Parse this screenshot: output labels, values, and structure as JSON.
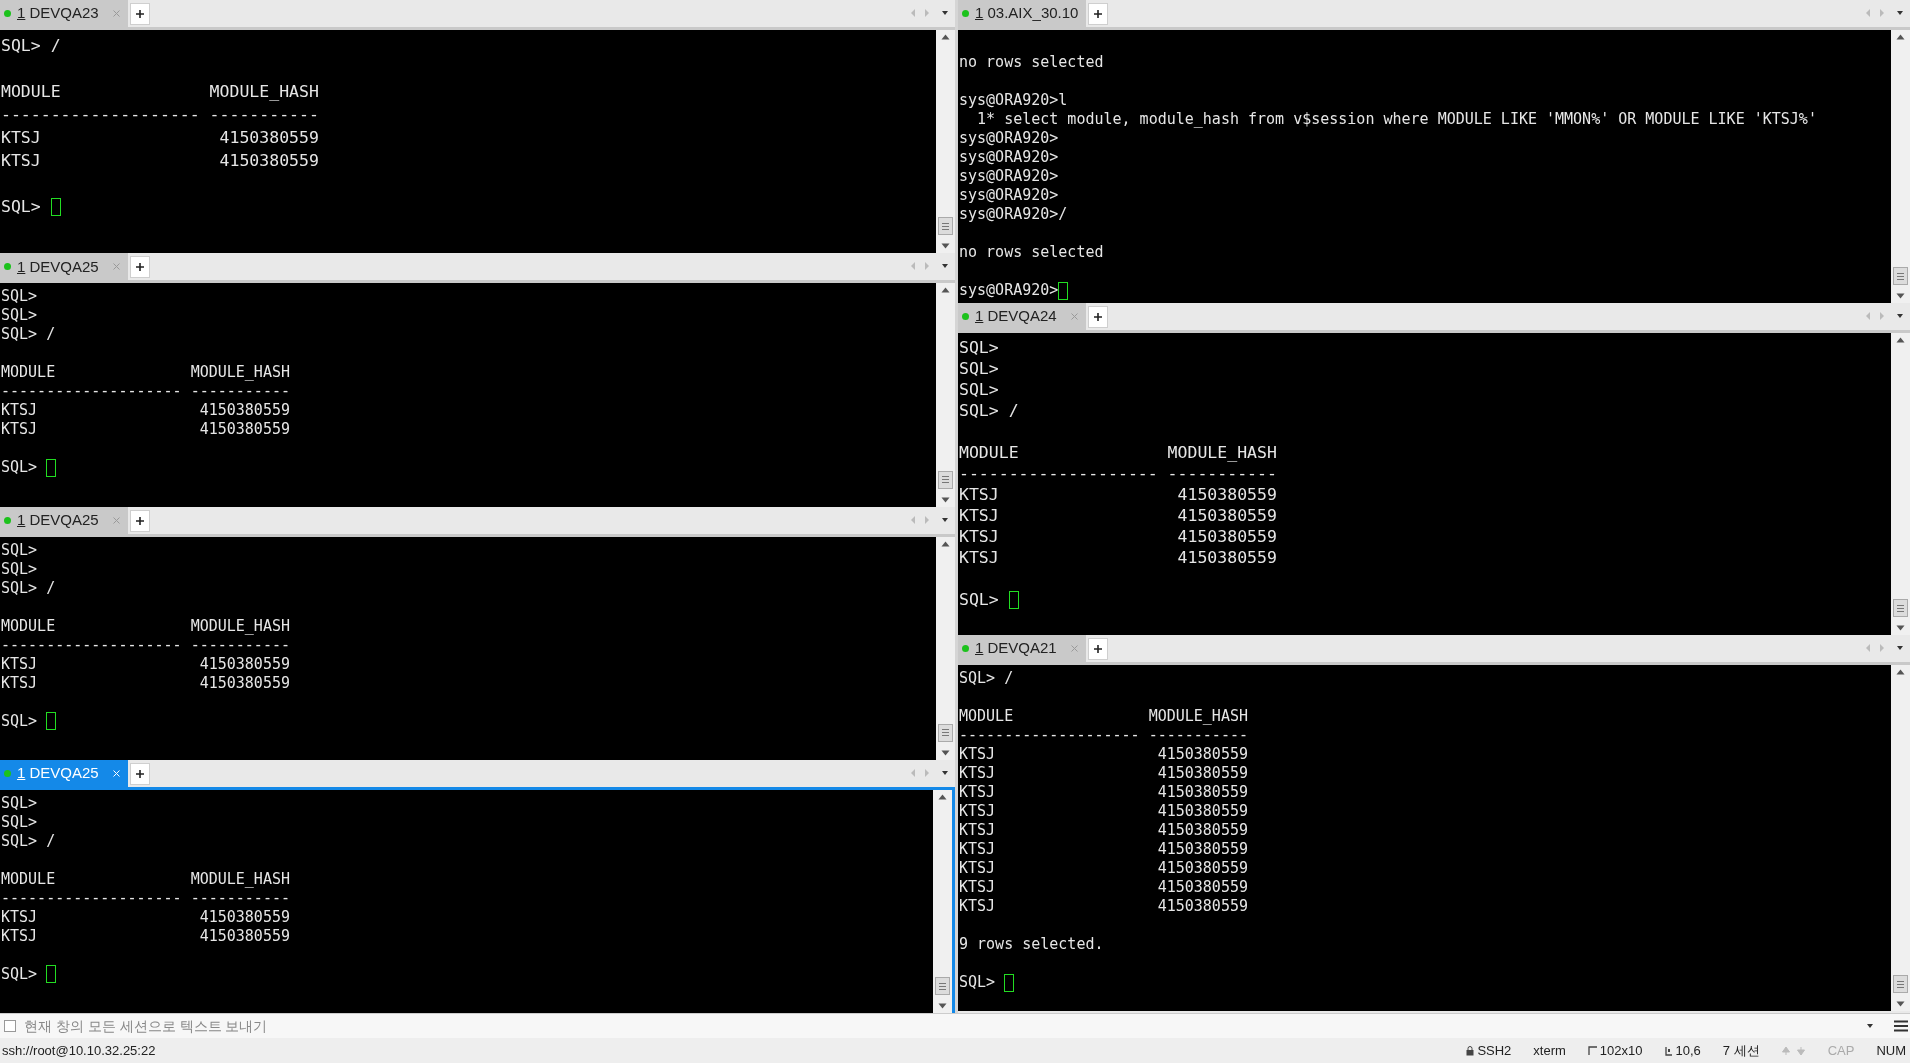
{
  "left_panes": [
    {
      "tab": {
        "number": "1",
        "name": "DEVQA23",
        "selected": false
      },
      "lines": [
        {
          "kind": "text",
          "text": "SQL> /"
        },
        {
          "kind": "blank"
        },
        {
          "kind": "text",
          "text": "MODULE               MODULE_HASH"
        },
        {
          "kind": "text",
          "text": "-------------------- -----------"
        },
        {
          "kind": "text",
          "text": "KTSJ                  4150380559"
        },
        {
          "kind": "text",
          "text": "KTSJ                  4150380559"
        },
        {
          "kind": "blank"
        },
        {
          "kind": "prompt",
          "text": "SQL> "
        }
      ]
    },
    {
      "tab": {
        "number": "1",
        "name": "DEVQA25",
        "selected": false
      },
      "lines": [
        {
          "kind": "text",
          "text": "SQL>"
        },
        {
          "kind": "text",
          "text": "SQL>"
        },
        {
          "kind": "text",
          "text": "SQL> /"
        },
        {
          "kind": "blank"
        },
        {
          "kind": "text",
          "text": "MODULE               MODULE_HASH"
        },
        {
          "kind": "text",
          "text": "-------------------- -----------"
        },
        {
          "kind": "text",
          "text": "KTSJ                  4150380559"
        },
        {
          "kind": "text",
          "text": "KTSJ                  4150380559"
        },
        {
          "kind": "blank"
        },
        {
          "kind": "prompt",
          "text": "SQL> "
        }
      ]
    },
    {
      "tab": {
        "number": "1",
        "name": "DEVQA25",
        "selected": false
      },
      "lines": [
        {
          "kind": "text",
          "text": "SQL>"
        },
        {
          "kind": "text",
          "text": "SQL>"
        },
        {
          "kind": "text",
          "text": "SQL> /"
        },
        {
          "kind": "blank"
        },
        {
          "kind": "text",
          "text": "MODULE               MODULE_HASH"
        },
        {
          "kind": "text",
          "text": "-------------------- -----------"
        },
        {
          "kind": "text",
          "text": "KTSJ                  4150380559"
        },
        {
          "kind": "text",
          "text": "KTSJ                  4150380559"
        },
        {
          "kind": "blank"
        },
        {
          "kind": "prompt",
          "text": "SQL> "
        }
      ]
    },
    {
      "tab": {
        "number": "1",
        "name": "DEVQA25",
        "selected": true
      },
      "lines": [
        {
          "kind": "text",
          "text": "SQL>"
        },
        {
          "kind": "text",
          "text": "SQL>"
        },
        {
          "kind": "text",
          "text": "SQL> /"
        },
        {
          "kind": "blank"
        },
        {
          "kind": "text",
          "text": "MODULE               MODULE_HASH"
        },
        {
          "kind": "text",
          "text": "-------------------- -----------"
        },
        {
          "kind": "text",
          "text": "KTSJ                  4150380559"
        },
        {
          "kind": "text",
          "text": "KTSJ                  4150380559"
        },
        {
          "kind": "blank"
        },
        {
          "kind": "prompt",
          "text": "SQL> "
        }
      ]
    }
  ],
  "right_panes": [
    {
      "tab": {
        "number": "1",
        "name": "03.AIX_30.10",
        "selected": false
      },
      "lines": [
        {
          "kind": "blank"
        },
        {
          "kind": "text",
          "text": "no rows selected"
        },
        {
          "kind": "blank"
        },
        {
          "kind": "text",
          "text": "sys@ORA920>l"
        },
        {
          "kind": "text",
          "text": "  1* select module, module_hash from v$session where MODULE LIKE 'MMON%' OR MODULE LIKE 'KTSJ%'"
        },
        {
          "kind": "text",
          "text": "sys@ORA920>"
        },
        {
          "kind": "text",
          "text": "sys@ORA920>"
        },
        {
          "kind": "text",
          "text": "sys@ORA920>"
        },
        {
          "kind": "text",
          "text": "sys@ORA920>"
        },
        {
          "kind": "text",
          "text": "sys@ORA920>/"
        },
        {
          "kind": "blank"
        },
        {
          "kind": "text",
          "text": "no rows selected"
        },
        {
          "kind": "blank"
        },
        {
          "kind": "prompt",
          "text": "sys@ORA920>"
        }
      ]
    },
    {
      "tab": {
        "number": "1",
        "name": "DEVQA24",
        "selected": false
      },
      "lines": [
        {
          "kind": "text",
          "text": "SQL>"
        },
        {
          "kind": "text",
          "text": "SQL>"
        },
        {
          "kind": "text",
          "text": "SQL>"
        },
        {
          "kind": "text",
          "text": "SQL> /"
        },
        {
          "kind": "blank"
        },
        {
          "kind": "text",
          "text": "MODULE               MODULE_HASH"
        },
        {
          "kind": "text",
          "text": "-------------------- -----------"
        },
        {
          "kind": "text",
          "text": "KTSJ                  4150380559"
        },
        {
          "kind": "text",
          "text": "KTSJ                  4150380559"
        },
        {
          "kind": "text",
          "text": "KTSJ                  4150380559"
        },
        {
          "kind": "text",
          "text": "KTSJ                  4150380559"
        },
        {
          "kind": "blank"
        },
        {
          "kind": "prompt",
          "text": "SQL> "
        }
      ]
    },
    {
      "tab": {
        "number": "1",
        "name": "DEVQA21",
        "selected": false
      },
      "lines": [
        {
          "kind": "text",
          "text": "SQL> /"
        },
        {
          "kind": "blank"
        },
        {
          "kind": "text",
          "text": "MODULE               MODULE_HASH"
        },
        {
          "kind": "text",
          "text": "-------------------- -----------"
        },
        {
          "kind": "text",
          "text": "KTSJ                  4150380559"
        },
        {
          "kind": "text",
          "text": "KTSJ                  4150380559"
        },
        {
          "kind": "text",
          "text": "KTSJ                  4150380559"
        },
        {
          "kind": "text",
          "text": "KTSJ                  4150380559"
        },
        {
          "kind": "text",
          "text": "KTSJ                  4150380559"
        },
        {
          "kind": "text",
          "text": "KTSJ                  4150380559"
        },
        {
          "kind": "text",
          "text": "KTSJ                  4150380559"
        },
        {
          "kind": "text",
          "text": "KTSJ                  4150380559"
        },
        {
          "kind": "text",
          "text": "KTSJ                  4150380559"
        },
        {
          "kind": "blank"
        },
        {
          "kind": "text",
          "text": "9 rows selected."
        },
        {
          "kind": "blank"
        },
        {
          "kind": "prompt",
          "text": "SQL> "
        }
      ]
    }
  ],
  "send_bar": {
    "checked": false,
    "label": "현재 창의 모든 세션으로 텍스트 보내기"
  },
  "status_bar": {
    "address": "ssh://root@10.10.32.25:22",
    "items": [
      {
        "kind": "lock",
        "text": "SSH2"
      },
      {
        "kind": "plain",
        "text": "xterm"
      },
      {
        "kind": "size",
        "text": "102x10"
      },
      {
        "kind": "cursor",
        "text": "10,6"
      },
      {
        "kind": "plain",
        "text": "7 세션"
      },
      {
        "kind": "arrows"
      },
      {
        "kind": "key",
        "text": "CAP",
        "on": false
      },
      {
        "kind": "key",
        "text": "NUM",
        "on": true
      }
    ]
  }
}
